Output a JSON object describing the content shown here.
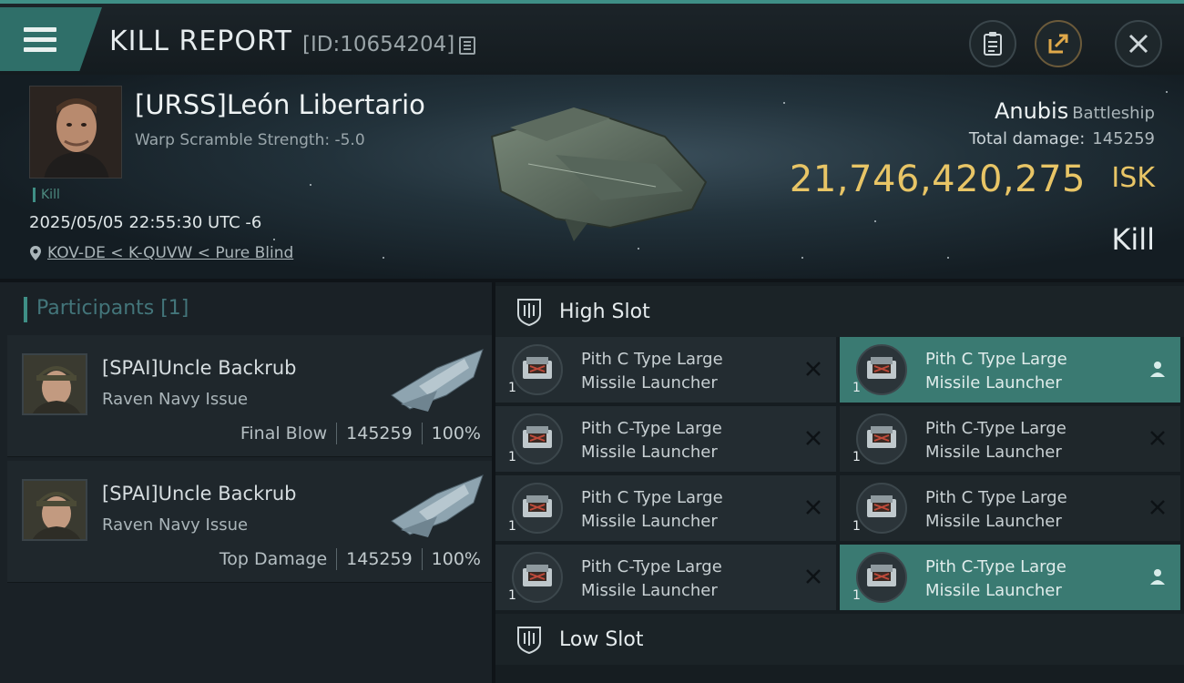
{
  "titlebar": {
    "title": "KILL REPORT",
    "id_text": "[ID:10654204]"
  },
  "victim": {
    "name": "[URSS]León Libertario",
    "warp_scramble": "Warp Scramble Strength: -5.0",
    "kill_tag": "Kill",
    "timestamp": "2025/05/05 22:55:30 UTC -6",
    "location": "KOV-DE < K-QUVW < Pure Blind"
  },
  "ship": {
    "name": "Anubis",
    "class": "Battleship",
    "total_damage_label": "Total damage:",
    "total_damage_value": "145259",
    "isk_value": "21,746,420,275",
    "isk_unit": "ISK",
    "result_label": "Kill"
  },
  "participants": {
    "header": "Participants [1]",
    "rows": [
      {
        "name": "[SPAI]Uncle Backrub",
        "ship": "Raven Navy Issue",
        "label": "Final Blow",
        "damage": "145259",
        "percent": "100%"
      },
      {
        "name": "[SPAI]Uncle Backrub",
        "ship": "Raven Navy Issue",
        "label": "Top Damage",
        "damage": "145259",
        "percent": "100%"
      }
    ]
  },
  "slots": {
    "high_title": "High Slot",
    "low_title": "Low Slot",
    "modules": [
      {
        "line1": "Pith C Type Large",
        "line2": "Missile Launcher",
        "qty": "1",
        "status": "destroyed",
        "status_icon": "close-icon"
      },
      {
        "line1": "Pith C Type Large",
        "line2": "Missile Launcher",
        "qty": "1",
        "status": "dropped",
        "status_icon": "person-icon"
      },
      {
        "line1": "Pith C-Type Large",
        "line2": "Missile Launcher",
        "qty": "1",
        "status": "destroyed",
        "status_icon": "close-icon"
      },
      {
        "line1": "Pith C-Type Large",
        "line2": "Missile Launcher",
        "qty": "1",
        "status": "destroyed",
        "status_icon": "close-icon"
      },
      {
        "line1": "Pith C Type Large",
        "line2": "Missile Launcher",
        "qty": "1",
        "status": "destroyed",
        "status_icon": "close-icon"
      },
      {
        "line1": "Pith C Type Large",
        "line2": "Missile Launcher",
        "qty": "1",
        "status": "destroyed",
        "status_icon": "close-icon"
      },
      {
        "line1": "Pith C-Type Large",
        "line2": "Missile Launcher",
        "qty": "1",
        "status": "destroyed",
        "status_icon": "close-icon"
      },
      {
        "line1": "Pith C-Type Large",
        "line2": "Missile Launcher",
        "qty": "1",
        "status": "dropped",
        "status_icon": "person-icon"
      }
    ]
  },
  "colors": {
    "accent_teal": "#3f8f86",
    "isk_gold": "#e8c566",
    "dropped_bg": "#3a7a72"
  }
}
